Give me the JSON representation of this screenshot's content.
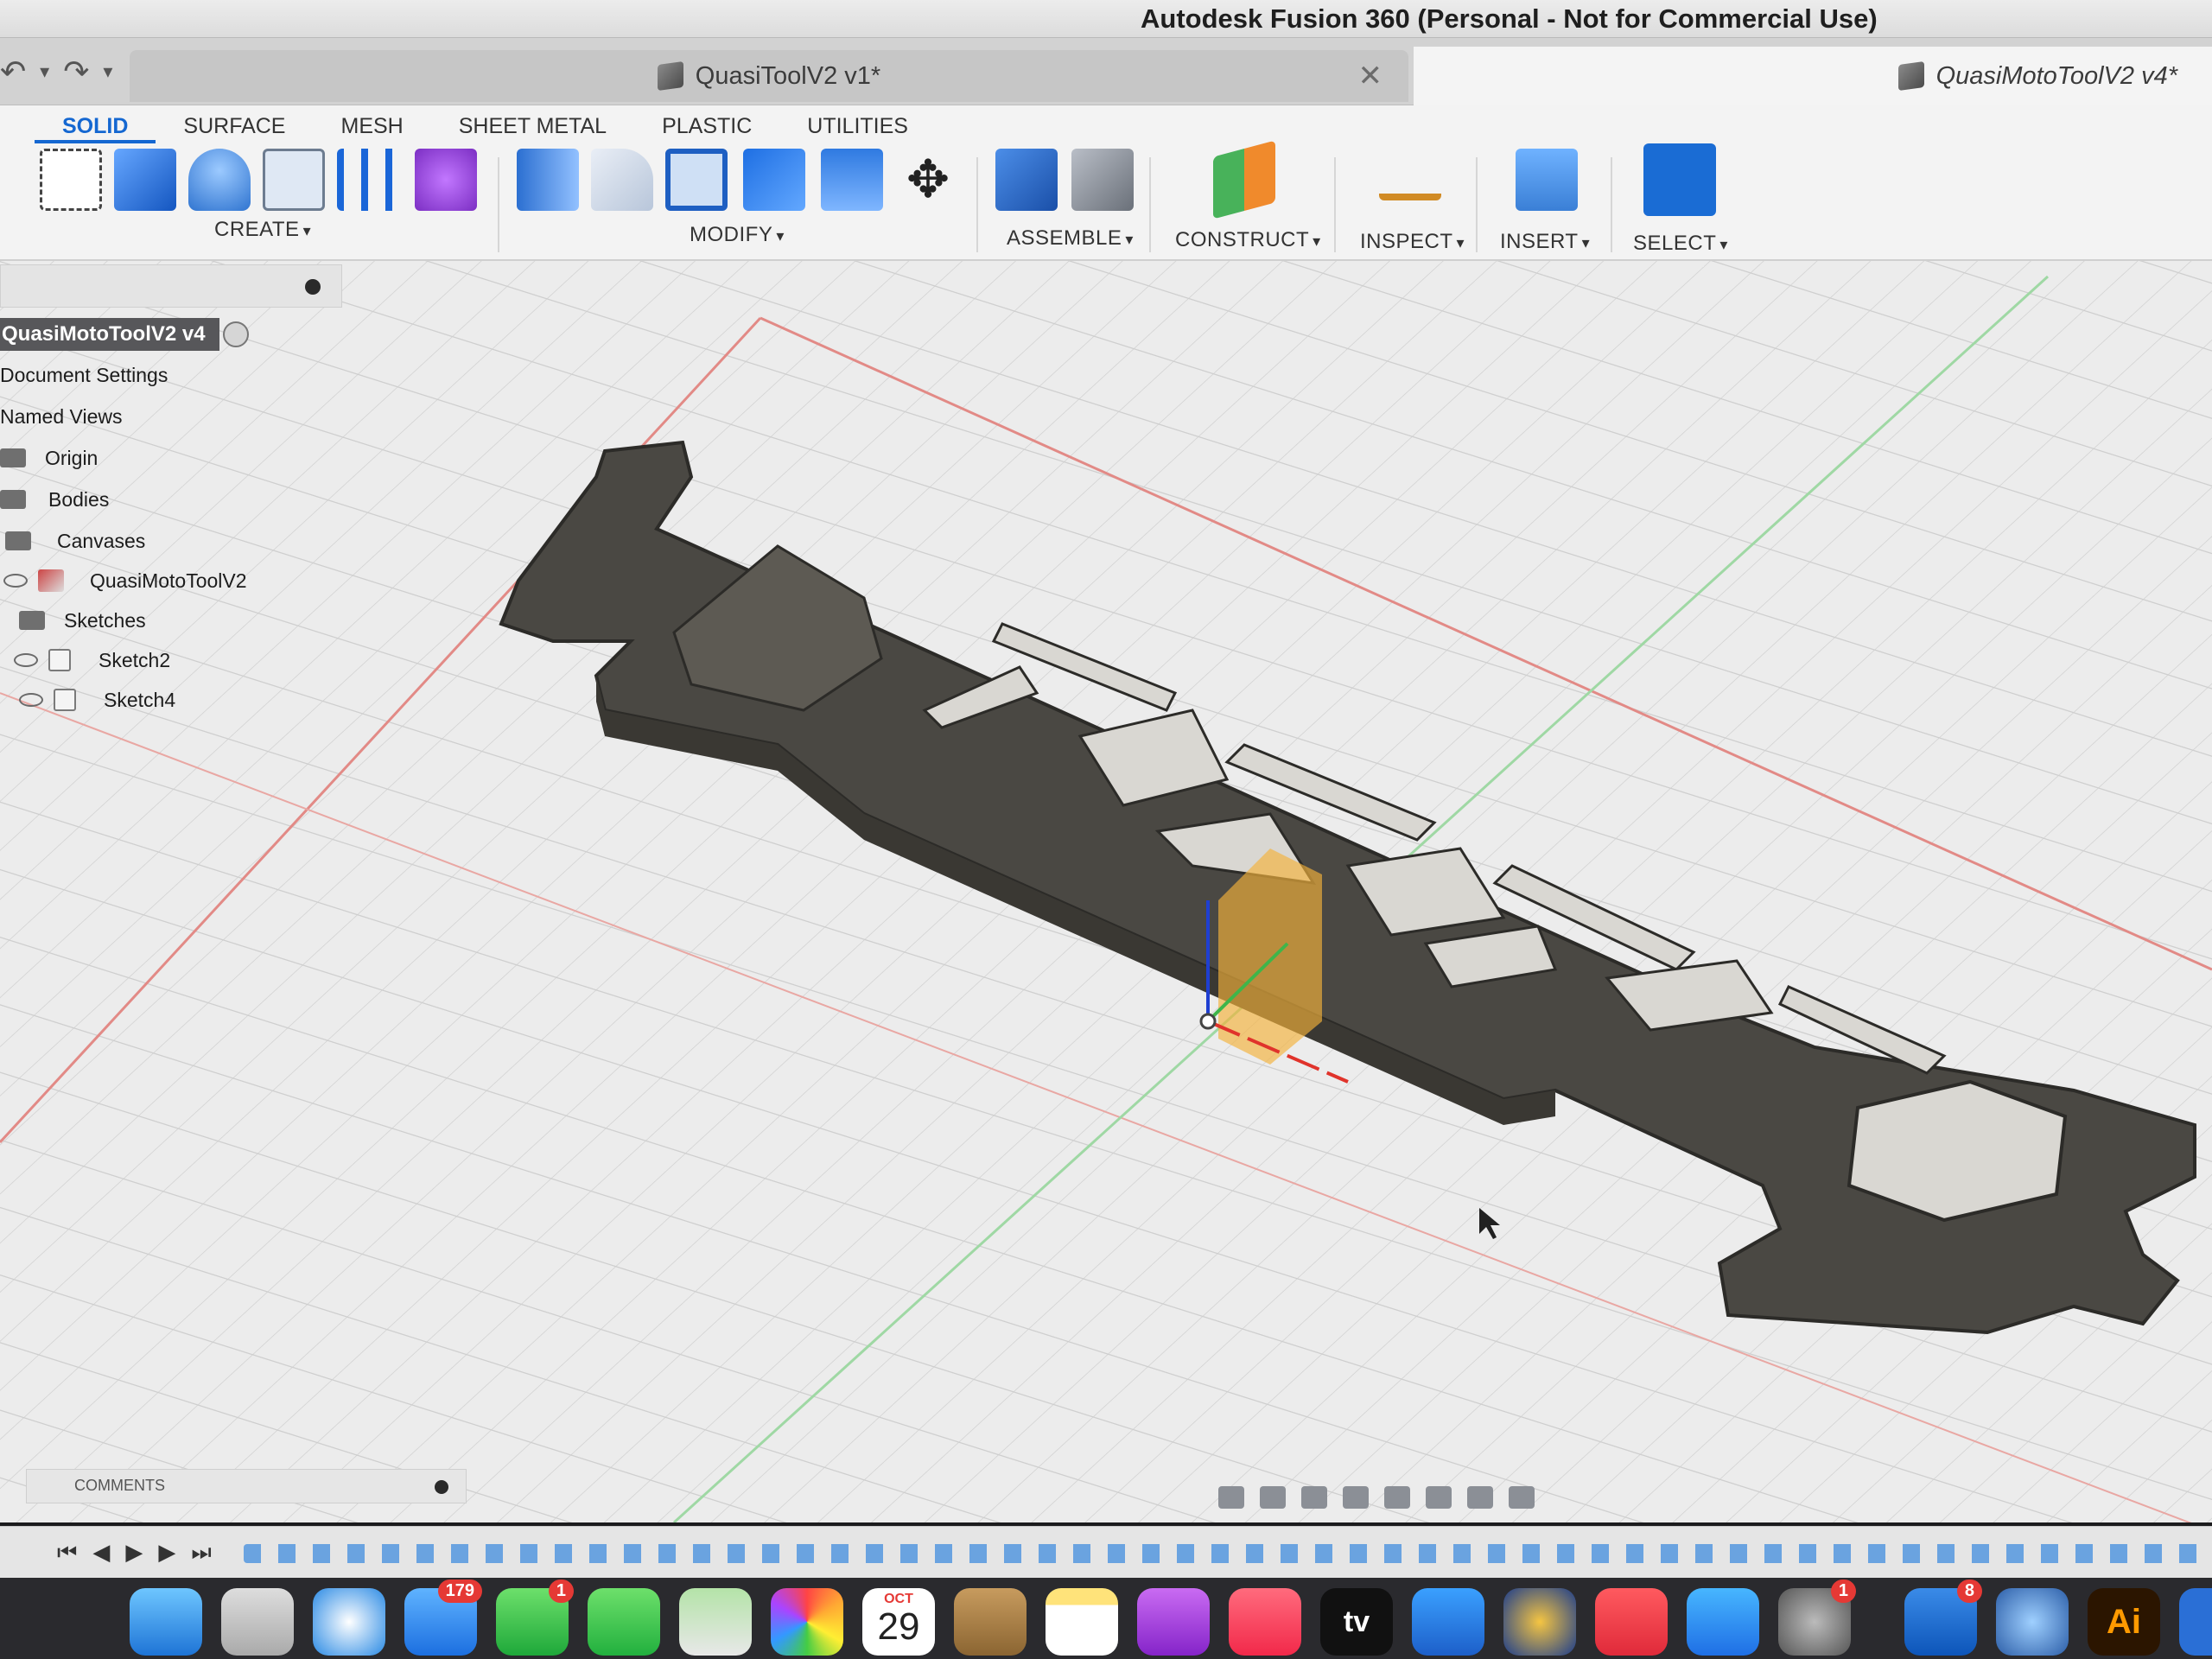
{
  "app": {
    "title": "Autodesk Fusion 360 (Personal - Not for Commercial Use)"
  },
  "tabs": {
    "inactive": {
      "label": "QuasiToolV2 v1*"
    },
    "active": {
      "label": "QuasiMotoToolV2 v4*"
    }
  },
  "ribbon": {
    "tabs": [
      "SOLID",
      "SURFACE",
      "MESH",
      "SHEET METAL",
      "PLASTIC",
      "UTILITIES"
    ],
    "groups": {
      "create": "CREATE",
      "modify": "MODIFY",
      "assemble": "ASSEMBLE",
      "construct": "CONSTRUCT",
      "inspect": "INSPECT",
      "insert": "INSERT",
      "select": "SELECT"
    }
  },
  "browser": {
    "root": "QuasiMotoToolV2 v4",
    "items": {
      "doc_settings": "Document Settings",
      "named_views": "Named Views",
      "origin": "Origin",
      "bodies": "Bodies",
      "canvases": "Canvases",
      "canvas_item": "QuasiMotoToolV2",
      "sketches": "Sketches",
      "sketch2": "Sketch2",
      "sketch4": "Sketch4"
    }
  },
  "comments": {
    "label": "COMMENTS"
  },
  "dock": {
    "mail_badge": "179",
    "facetime_badge": "1",
    "calendar_month": "OCT",
    "calendar_day": "29",
    "tv_label": "tv",
    "prefs_badge": "1",
    "outlook_badge": "8",
    "illustrator_label": "Ai"
  },
  "colors": {
    "accent": "#1467d1",
    "model": "#4a4843",
    "axis_x": "#e0332b",
    "axis_y": "#3fb54a",
    "axis_z": "#1f3fd1",
    "origin_box": "#f4b23a"
  }
}
